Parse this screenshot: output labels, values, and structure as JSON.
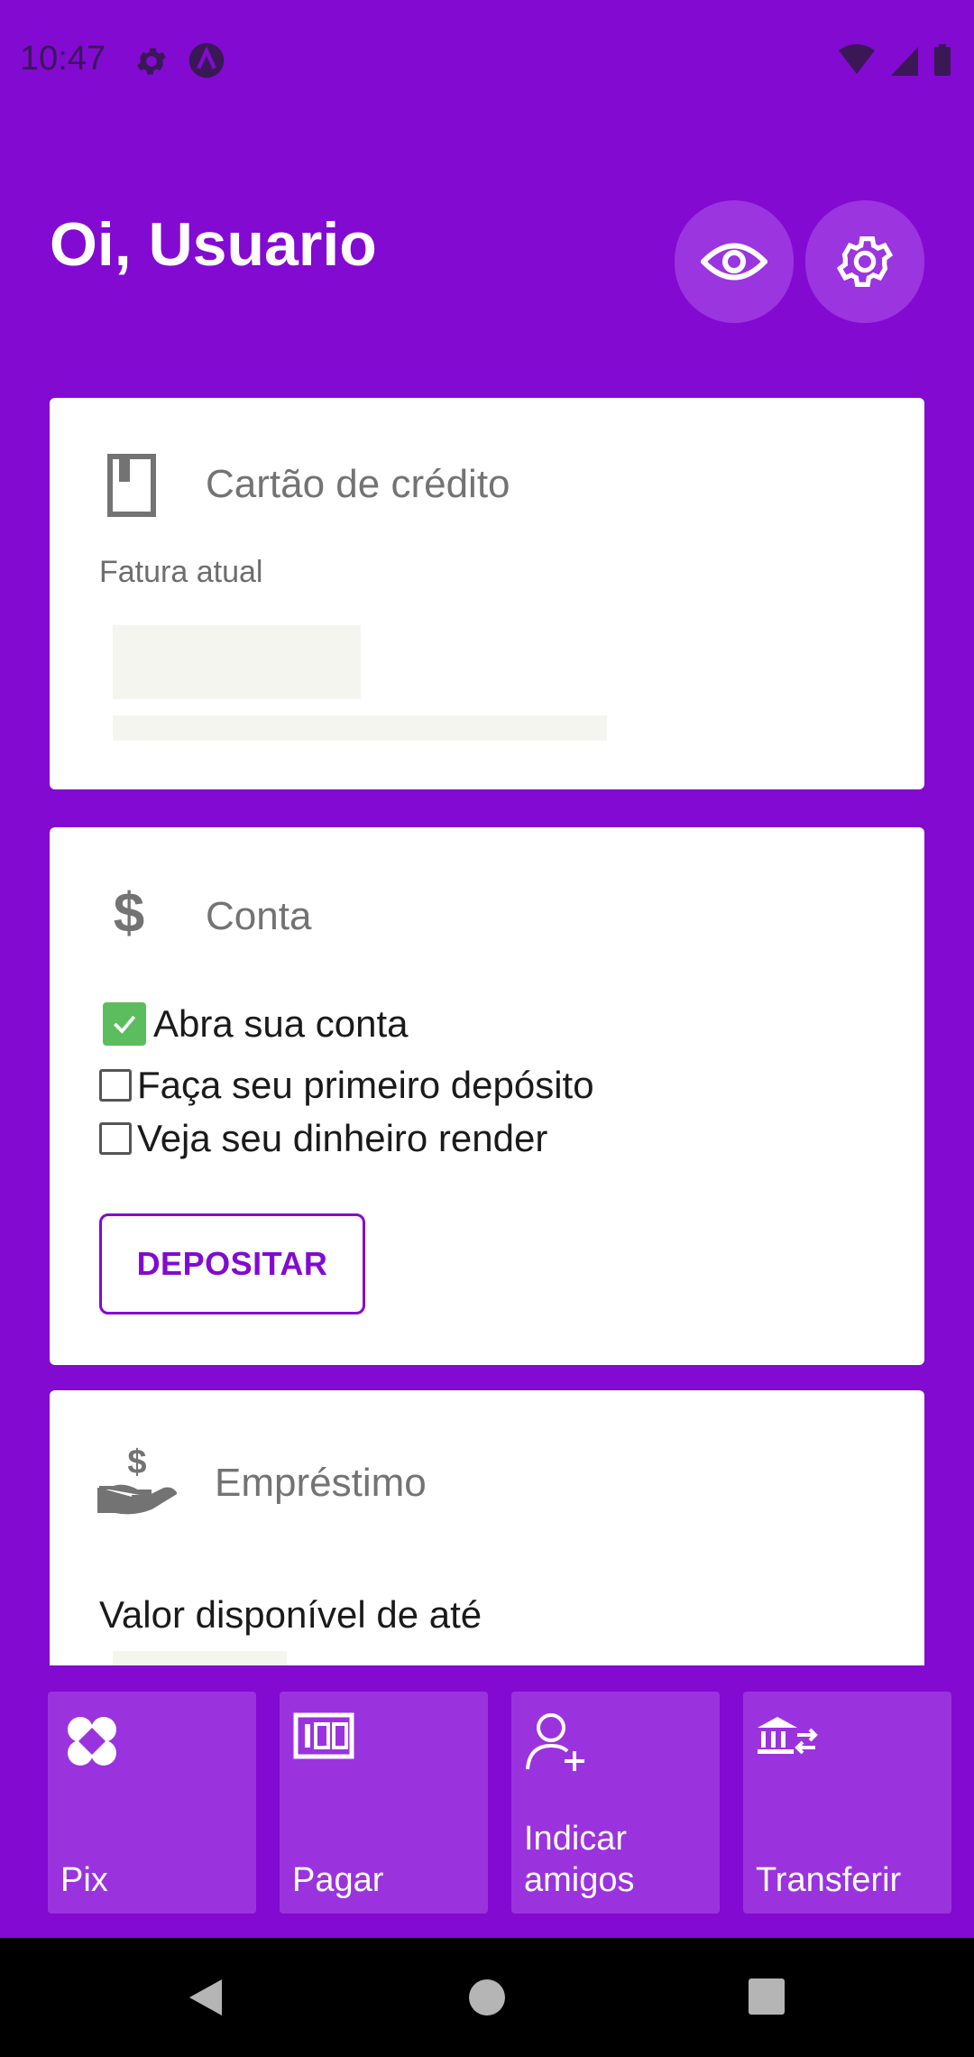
{
  "status_bar": {
    "time": "10:47",
    "icons": [
      "gear-icon",
      "app-icon",
      "wifi-icon",
      "signal-icon",
      "battery-icon"
    ]
  },
  "header": {
    "greeting": "Oi, Usuario",
    "buttons": [
      "eye-icon",
      "gear-icon"
    ]
  },
  "credit_card": {
    "title": "Cartão de crédito",
    "label": "Fatura atual",
    "icon": "credit-card-icon"
  },
  "account": {
    "title": "Conta",
    "icon": "dollar-icon",
    "checklist": [
      {
        "label": "Abra sua conta",
        "checked": true
      },
      {
        "label": "Faça seu primeiro depósito",
        "checked": false
      },
      {
        "label": "Veja seu dinheiro render",
        "checked": false
      }
    ],
    "deposit_label": "DEPOSITAR"
  },
  "loan": {
    "title": "Empréstimo",
    "icon": "hand-money-icon",
    "text": "Valor disponível de até"
  },
  "shortcuts": [
    {
      "label": "Pix",
      "icon": "pix-icon"
    },
    {
      "label": "Pagar",
      "icon": "barcode-icon"
    },
    {
      "label": "Indicar\namigos",
      "icon": "add-user-icon"
    },
    {
      "label": "Transferir",
      "icon": "bank-transfer-icon"
    }
  ],
  "colors": {
    "brand": "#820ad1",
    "check_green": "#5bbd5e"
  }
}
